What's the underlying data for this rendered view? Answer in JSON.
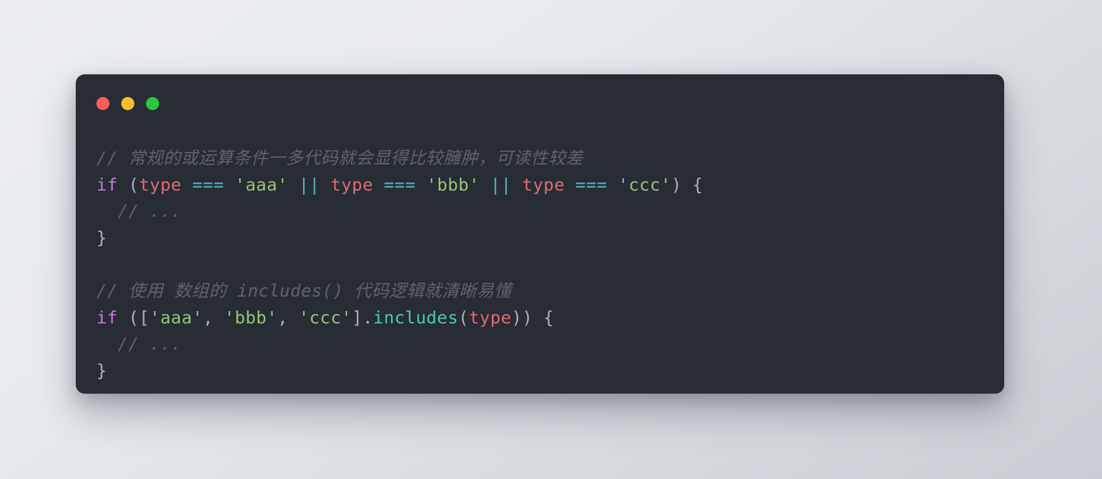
{
  "window": {
    "traffic_lights": [
      {
        "name": "close-dot",
        "color": "#ff5f56"
      },
      {
        "name": "minimize-dot",
        "color": "#ffbd2e"
      },
      {
        "name": "maximize-dot",
        "color": "#27c93f"
      }
    ],
    "background_color": "#282c34",
    "page_background": "#e6e9ed"
  },
  "theme": {
    "comment": "#5c6370",
    "keyword": "#c678dd",
    "variable": "#e06c75",
    "operator": "#56b6c2",
    "string": "#98c379",
    "function": "#4ec9b0",
    "punctuation": "#abb2bf"
  },
  "code": {
    "lines": [
      {
        "id": "line-1-comment",
        "tokens": [
          {
            "t": "// 常规的或运算条件一多代码就会显得比较臃肿，可读性较差",
            "c": "cmt"
          }
        ]
      },
      {
        "id": "line-2-if-or-chain",
        "tokens": [
          {
            "t": "if",
            "c": "kw"
          },
          {
            "t": " (",
            "c": "pun"
          },
          {
            "t": "type",
            "c": "var"
          },
          {
            "t": " ",
            "c": "pun"
          },
          {
            "t": "===",
            "c": "op"
          },
          {
            "t": " ",
            "c": "pun"
          },
          {
            "t": "'aaa'",
            "c": "str"
          },
          {
            "t": " ",
            "c": "pun"
          },
          {
            "t": "||",
            "c": "op"
          },
          {
            "t": " ",
            "c": "pun"
          },
          {
            "t": "type",
            "c": "var"
          },
          {
            "t": " ",
            "c": "pun"
          },
          {
            "t": "===",
            "c": "op"
          },
          {
            "t": " ",
            "c": "pun"
          },
          {
            "t": "'bbb'",
            "c": "str"
          },
          {
            "t": " ",
            "c": "pun"
          },
          {
            "t": "||",
            "c": "op"
          },
          {
            "t": " ",
            "c": "pun"
          },
          {
            "t": "type",
            "c": "var"
          },
          {
            "t": " ",
            "c": "pun"
          },
          {
            "t": "===",
            "c": "op"
          },
          {
            "t": " ",
            "c": "pun"
          },
          {
            "t": "'ccc'",
            "c": "str"
          },
          {
            "t": ") {",
            "c": "pun"
          }
        ]
      },
      {
        "id": "line-3-ellipsis-comment",
        "tokens": [
          {
            "t": "  // ...",
            "c": "cmt"
          }
        ]
      },
      {
        "id": "line-4-close-brace",
        "tokens": [
          {
            "t": "}",
            "c": "pun"
          }
        ]
      },
      {
        "id": "line-5-blank",
        "tokens": []
      },
      {
        "id": "line-6-comment",
        "tokens": [
          {
            "t": "// 使用 数组的 includes() 代码逻辑就清晰易懂",
            "c": "cmt"
          }
        ]
      },
      {
        "id": "line-7-if-includes",
        "tokens": [
          {
            "t": "if",
            "c": "kw"
          },
          {
            "t": " ([",
            "c": "pun"
          },
          {
            "t": "'aaa'",
            "c": "str"
          },
          {
            "t": ", ",
            "c": "pun"
          },
          {
            "t": "'bbb'",
            "c": "str"
          },
          {
            "t": ", ",
            "c": "pun"
          },
          {
            "t": "'ccc'",
            "c": "str"
          },
          {
            "t": "].",
            "c": "pun"
          },
          {
            "t": "includes",
            "c": "fn"
          },
          {
            "t": "(",
            "c": "pun"
          },
          {
            "t": "type",
            "c": "var"
          },
          {
            "t": ")) {",
            "c": "pun"
          }
        ]
      },
      {
        "id": "line-8-ellipsis-comment",
        "tokens": [
          {
            "t": "  // ...",
            "c": "cmt"
          }
        ]
      },
      {
        "id": "line-9-close-brace",
        "tokens": [
          {
            "t": "}",
            "c": "pun"
          }
        ]
      }
    ]
  }
}
